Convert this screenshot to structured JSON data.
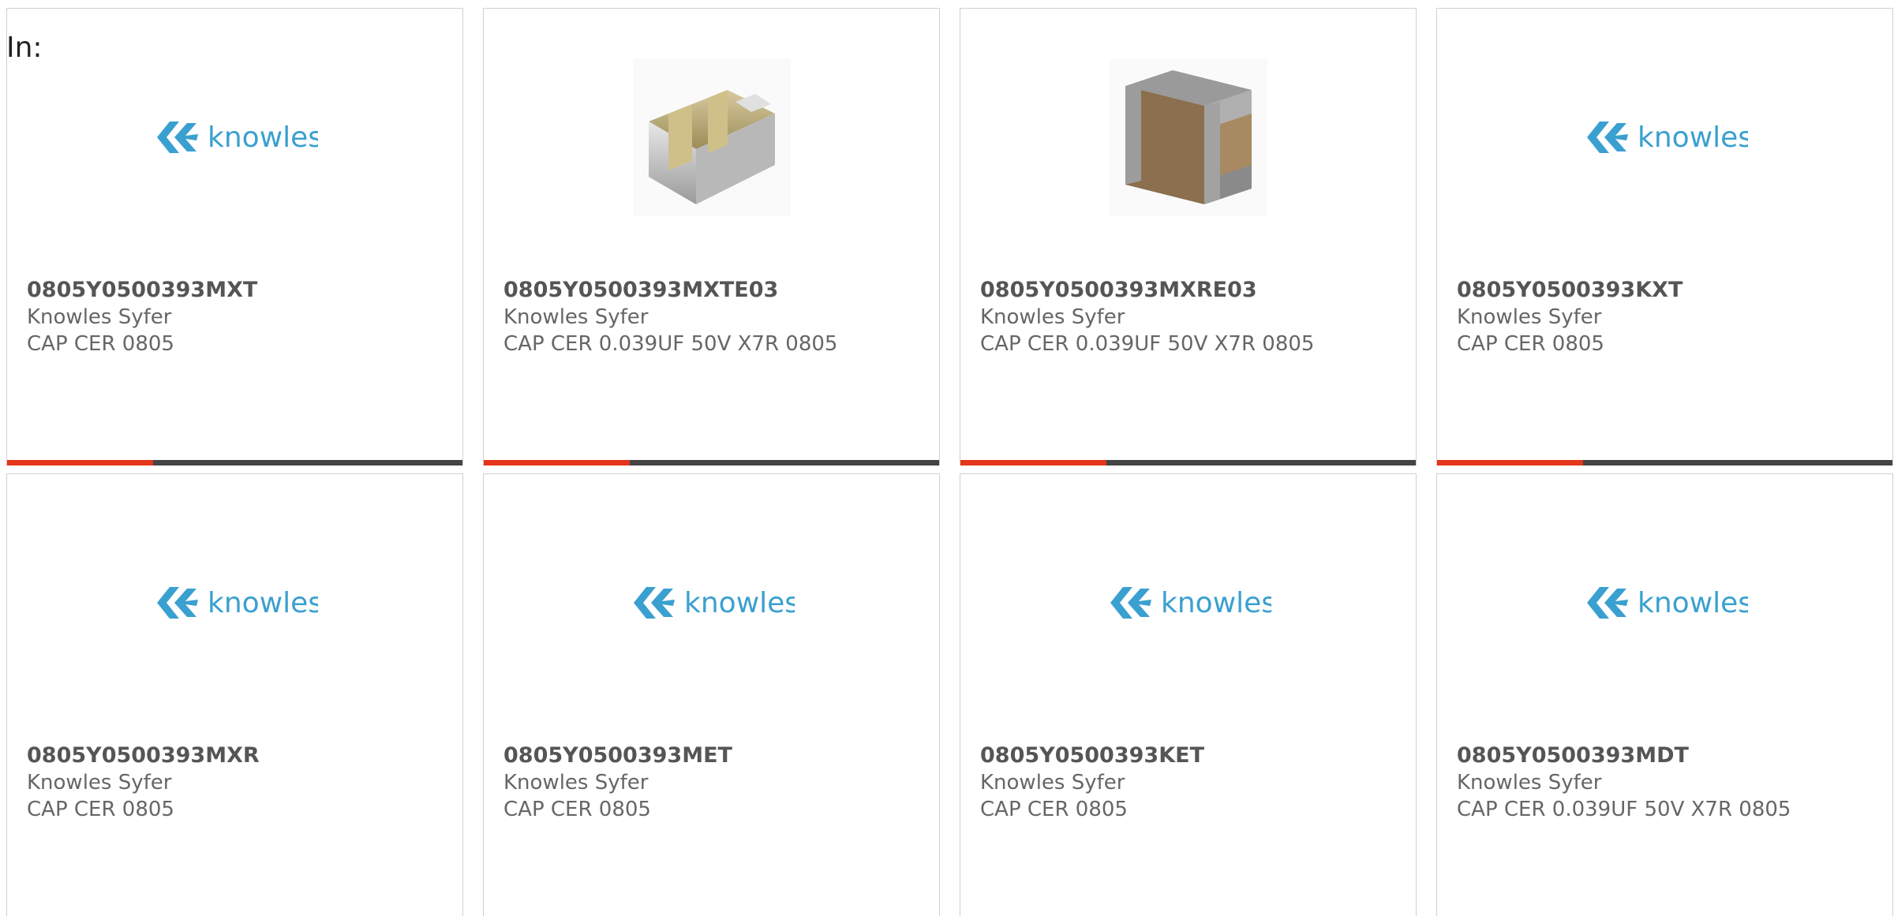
{
  "header": {
    "label": "In:"
  },
  "colors": {
    "progress_fill": "#e3361b",
    "progress_track": "#444444",
    "logo": "#3aa0d0"
  },
  "products": [
    {
      "part": "0805Y0500393MXT",
      "manufacturer": "Knowles Syfer",
      "description": "CAP CER 0805",
      "image": "knowles-logo",
      "progress": 0.32
    },
    {
      "part": "0805Y0500393MXTE03",
      "manufacturer": "Knowles Syfer",
      "description": "CAP CER 0.039UF 50V X7R 0805",
      "image": "capacitor-photo-striped",
      "progress": 0.32
    },
    {
      "part": "0805Y0500393MXRE03",
      "manufacturer": "Knowles Syfer",
      "description": "CAP CER 0.039UF 50V X7R 0805",
      "image": "capacitor-photo-brown",
      "progress": 0.32
    },
    {
      "part": "0805Y0500393KXT",
      "manufacturer": "Knowles Syfer",
      "description": "CAP CER 0805",
      "image": "knowles-logo",
      "progress": 0.32
    },
    {
      "part": "0805Y0500393MXR",
      "manufacturer": "Knowles Syfer",
      "description": "CAP CER 0805",
      "image": "knowles-logo"
    },
    {
      "part": "0805Y0500393MET",
      "manufacturer": "Knowles Syfer",
      "description": "CAP CER 0805",
      "image": "knowles-logo"
    },
    {
      "part": "0805Y0500393KET",
      "manufacturer": "Knowles Syfer",
      "description": "CAP CER 0805",
      "image": "knowles-logo"
    },
    {
      "part": "0805Y0500393MDT",
      "manufacturer": "Knowles Syfer",
      "description": "CAP CER 0.039UF 50V X7R 0805",
      "image": "knowles-logo"
    }
  ],
  "logo_text": "knowles"
}
